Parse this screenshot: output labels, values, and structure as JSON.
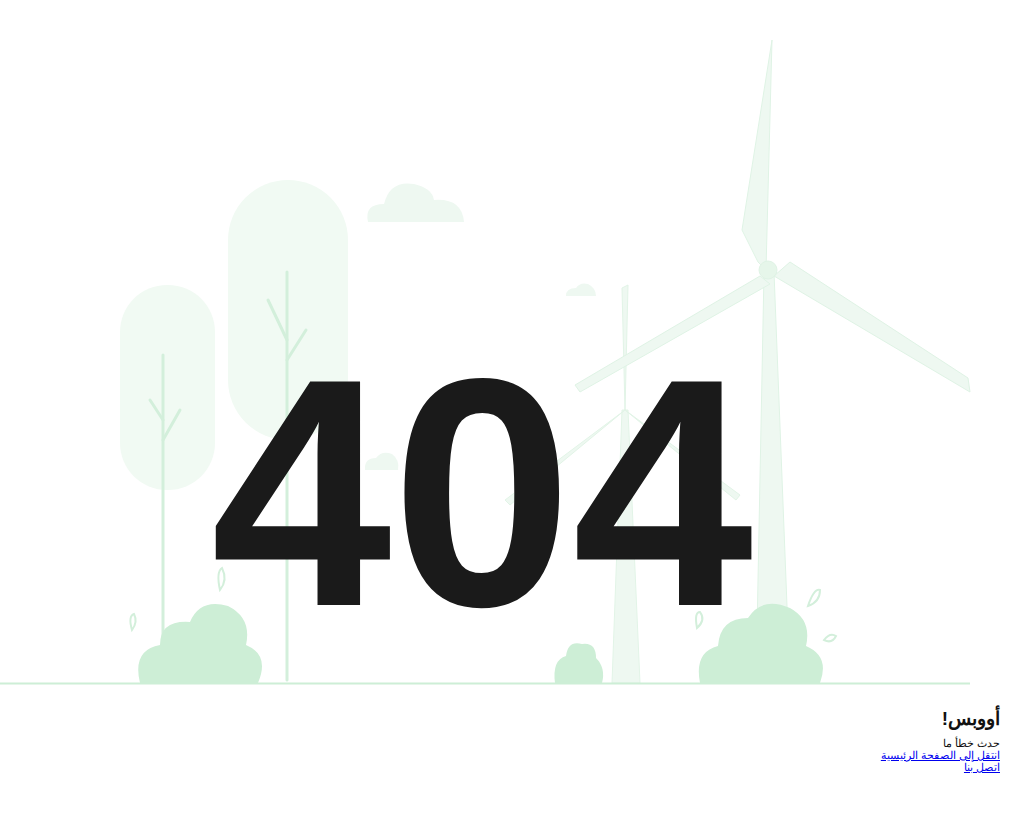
{
  "illustration": {
    "code": "404"
  },
  "heading": "أووبس!",
  "message": "حدث خطأ ما",
  "links": [
    {
      "label": "انتقل إلى الصفحة الرئيسية"
    },
    {
      "label": "اتصل بنا"
    }
  ]
}
